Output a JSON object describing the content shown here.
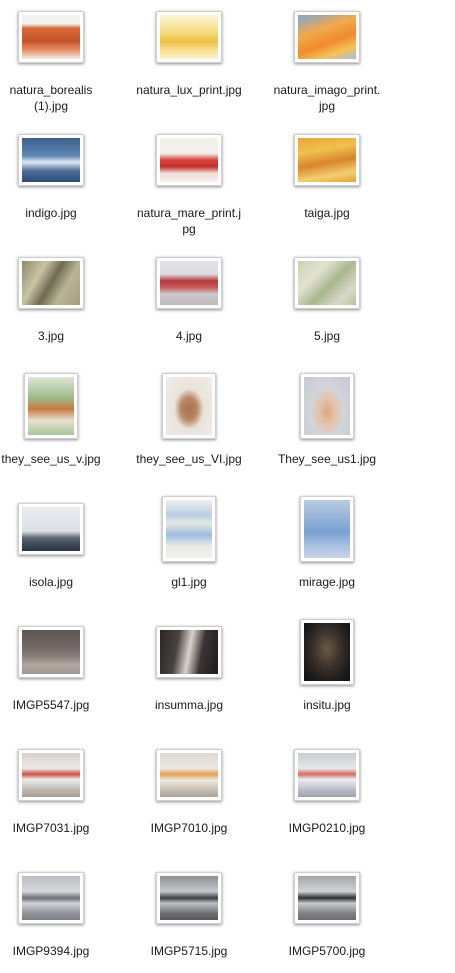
{
  "files": [
    {
      "name": "natura_borealis\n(1).jpg",
      "icon": "image-thumbnail-icon"
    },
    {
      "name": "natura_lux_print.jpg",
      "icon": "image-thumbnail-icon"
    },
    {
      "name": "natura_imago_print.\njpg",
      "icon": "image-thumbnail-icon"
    },
    {
      "name": "indigo.jpg",
      "icon": "image-thumbnail-icon"
    },
    {
      "name": "natura_mare_print.j\npg",
      "icon": "image-thumbnail-icon"
    },
    {
      "name": "taiga.jpg",
      "icon": "image-thumbnail-icon"
    },
    {
      "name": "3.jpg",
      "icon": "image-thumbnail-icon"
    },
    {
      "name": "4.jpg",
      "icon": "image-thumbnail-icon"
    },
    {
      "name": "5.jpg",
      "icon": "image-thumbnail-icon"
    },
    {
      "name": "they_see_us_v.jpg",
      "icon": "image-thumbnail-icon"
    },
    {
      "name": "they_see_us_VI.jpg",
      "icon": "image-thumbnail-icon"
    },
    {
      "name": "They_see_us1.jpg",
      "icon": "image-thumbnail-icon"
    },
    {
      "name": "isola.jpg",
      "icon": "image-thumbnail-icon"
    },
    {
      "name": "gl1.jpg",
      "icon": "image-thumbnail-icon"
    },
    {
      "name": "mirage.jpg",
      "icon": "image-thumbnail-icon"
    },
    {
      "name": "IMGP5547.jpg",
      "icon": "image-thumbnail-icon"
    },
    {
      "name": "insumma.jpg",
      "icon": "image-thumbnail-icon"
    },
    {
      "name": "insitu.jpg",
      "icon": "image-thumbnail-icon"
    },
    {
      "name": "IMGP7031.jpg",
      "icon": "image-thumbnail-icon"
    },
    {
      "name": "IMGP7010.jpg",
      "icon": "image-thumbnail-icon"
    },
    {
      "name": "IMGP0210.jpg",
      "icon": "image-thumbnail-icon"
    },
    {
      "name": "IMGP9394.jpg",
      "icon": "image-thumbnail-icon"
    },
    {
      "name": "IMGP5715.jpg",
      "icon": "image-thumbnail-icon"
    },
    {
      "name": "IMGP5700.jpg",
      "icon": "image-thumbnail-icon"
    }
  ]
}
